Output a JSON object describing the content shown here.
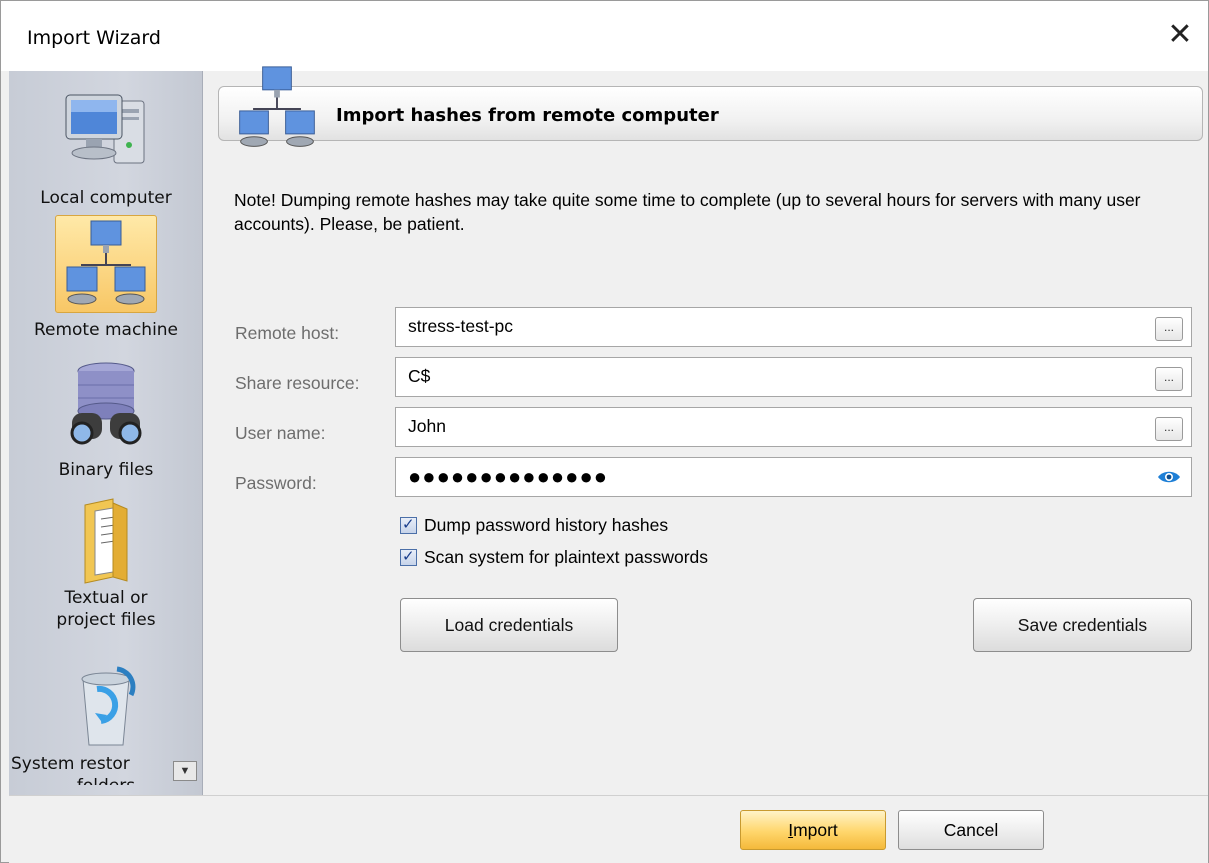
{
  "window": {
    "title": "Import Wizard",
    "close_glyph": "✕"
  },
  "sidebar": {
    "items": [
      {
        "label": "Local computer",
        "icon": "computer-icon"
      },
      {
        "label": "Remote machine",
        "icon": "network-computers-icon",
        "selected": true
      },
      {
        "label": "Binary files",
        "icon": "database-binoculars-icon"
      },
      {
        "label": "Textual or",
        "label2": "project files",
        "icon": "folder-document-icon"
      },
      {
        "label": "System restor",
        "label2": "folders",
        "icon": "recycle-bin-icon"
      }
    ],
    "scroll_glyph": "▼"
  },
  "header": {
    "title": "Import hashes from remote computer",
    "icon": "network-computers-icon"
  },
  "note": "Note! Dumping remote hashes may take quite some time to complete (up to several hours for servers with many user accounts). Please, be patient.",
  "form": {
    "remote_host": {
      "label": "Remote host:",
      "value": "stress-test-pc",
      "button": "..."
    },
    "share_resource": {
      "label": "Share resource:",
      "value": "C$",
      "button": "..."
    },
    "user_name": {
      "label": "User name:",
      "value": "John",
      "button": "..."
    },
    "password": {
      "label": "Password:",
      "value": "●●●●●●●●●●●●●●",
      "icon": "eye-icon"
    }
  },
  "options": {
    "dump_history": {
      "label": "Dump password history hashes",
      "checked": true
    },
    "scan_plaintext": {
      "label": "Scan system for plaintext passwords",
      "checked": true
    }
  },
  "buttons": {
    "load_credentials": "Load credentials",
    "save_credentials": "Save credentials",
    "import_first": "I",
    "import_rest": "mport",
    "cancel": "Cancel"
  }
}
